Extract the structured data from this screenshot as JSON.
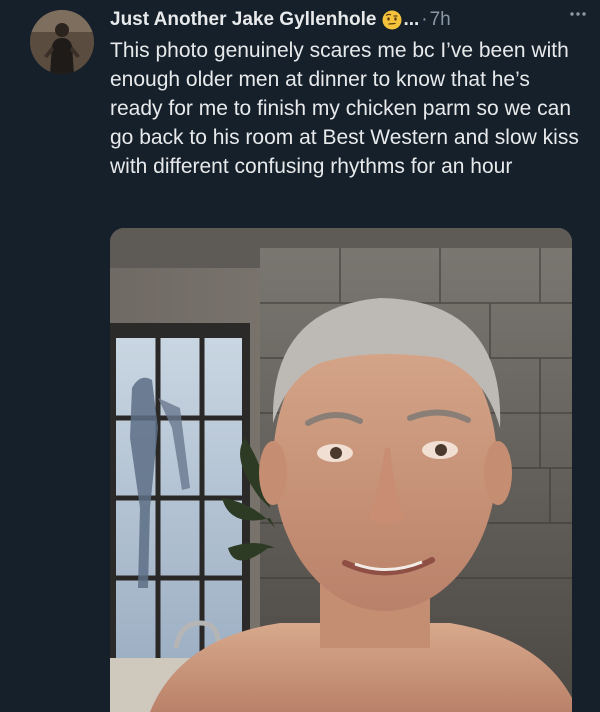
{
  "tweet": {
    "display_name": "Just Another Jake Gyllenhole",
    "emoji_icon": "face-with-raised-eyebrow-emoji",
    "truncation": "...",
    "separator": "·",
    "time_ago": "7h",
    "more_icon": "more-dots-icon",
    "text": "This photo genuinely scares me bc I’ve been with enough older men at dinner to know that he’s ready for me to finish my chicken parm so we can go back to his room at Best Western and slow kiss with different confusing rhythms for an hour"
  },
  "colors": {
    "background": "#15202b",
    "primary_text": "#e7e9ea",
    "secondary_text": "#8b98a5"
  }
}
